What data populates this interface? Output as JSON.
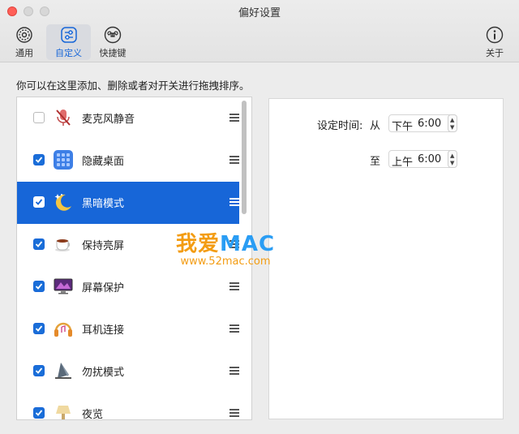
{
  "window": {
    "title": "偏好设置"
  },
  "toolbar": {
    "tabs": [
      {
        "label": "通用",
        "icon": "gear-icon"
      },
      {
        "label": "自定义",
        "icon": "sliders-icon",
        "active": true
      },
      {
        "label": "快捷键",
        "icon": "command-key-icon"
      }
    ],
    "about": {
      "label": "关于",
      "icon": "info-icon"
    }
  },
  "instruction": "你可以在这里添加、删除或者对开关进行拖拽排序。",
  "list": {
    "items": [
      {
        "label": "麦克风静音",
        "checked": false,
        "icon": "microphone-mute-icon"
      },
      {
        "label": "隐藏桌面",
        "checked": true,
        "icon": "desktop-grid-icon"
      },
      {
        "label": "黑暗模式",
        "checked": true,
        "icon": "moon-stars-icon",
        "selected": true
      },
      {
        "label": "保持亮屏",
        "checked": true,
        "icon": "coffee-cup-icon"
      },
      {
        "label": "屏幕保护",
        "checked": true,
        "icon": "screensaver-icon"
      },
      {
        "label": "耳机连接",
        "checked": true,
        "icon": "headphones-icon"
      },
      {
        "label": "勿扰模式",
        "checked": true,
        "icon": "do-not-disturb-icon"
      },
      {
        "label": "夜览",
        "checked": true,
        "icon": "night-shift-icon"
      }
    ]
  },
  "schedule": {
    "set_time_label": "设定时间:",
    "from_label": "从",
    "from_ampm": "下午",
    "from_time": "6:00",
    "to_label": "至",
    "to_ampm": "上午",
    "to_time": "6:00"
  },
  "watermark": {
    "brand_a": "我爱",
    "brand_b": "MAC",
    "url": "www.52mac.com"
  },
  "colors": {
    "accent": "#1766d8",
    "close": "#ff5f57"
  }
}
